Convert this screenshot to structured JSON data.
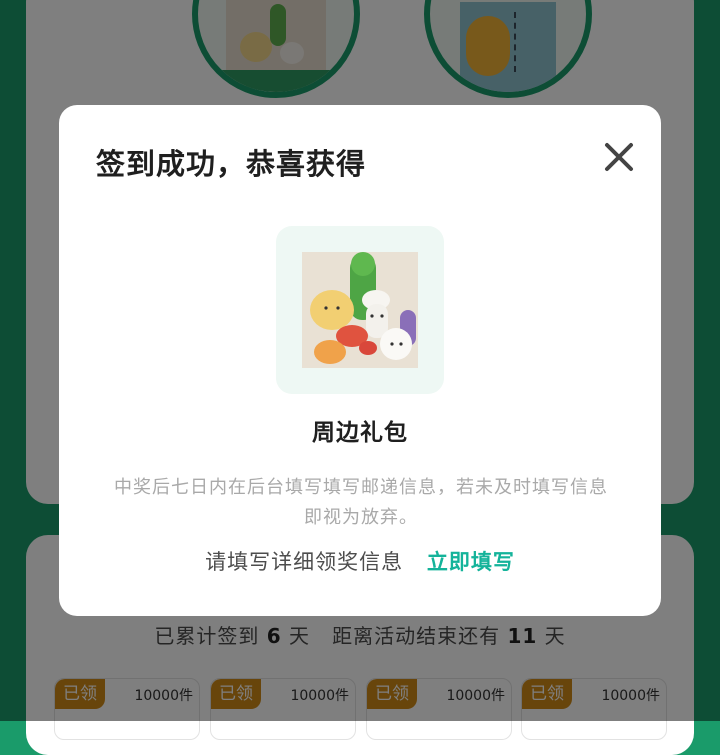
{
  "background": {
    "streak": {
      "prefix": "已累计签到",
      "days_signed": "6",
      "unit1": "天",
      "middle": "距离活动结束还有",
      "days_left": "11",
      "unit2": "天"
    },
    "reward_tiles": [
      {
        "badge": "已领",
        "count": "10000件"
      },
      {
        "badge": "已领",
        "count": "10000件"
      },
      {
        "badge": "已领",
        "count": "10000件"
      },
      {
        "badge": "已领",
        "count": "10000件"
      }
    ]
  },
  "modal": {
    "title": "签到成功，恭喜获得",
    "close_icon": "close-icon",
    "prize_name": "周边礼包",
    "notice": "中奖后七日内在后台填写填写邮递信息，若未及时填写信息即视为放弃。",
    "fill_prompt": "请填写详细领奖信息",
    "fill_link": "立即填写"
  },
  "colors": {
    "page_green": "#1a9b6a",
    "link_teal": "#14b39a",
    "badge_orange": "#d18a16",
    "prize_frame_bg": "#eef8f4"
  }
}
